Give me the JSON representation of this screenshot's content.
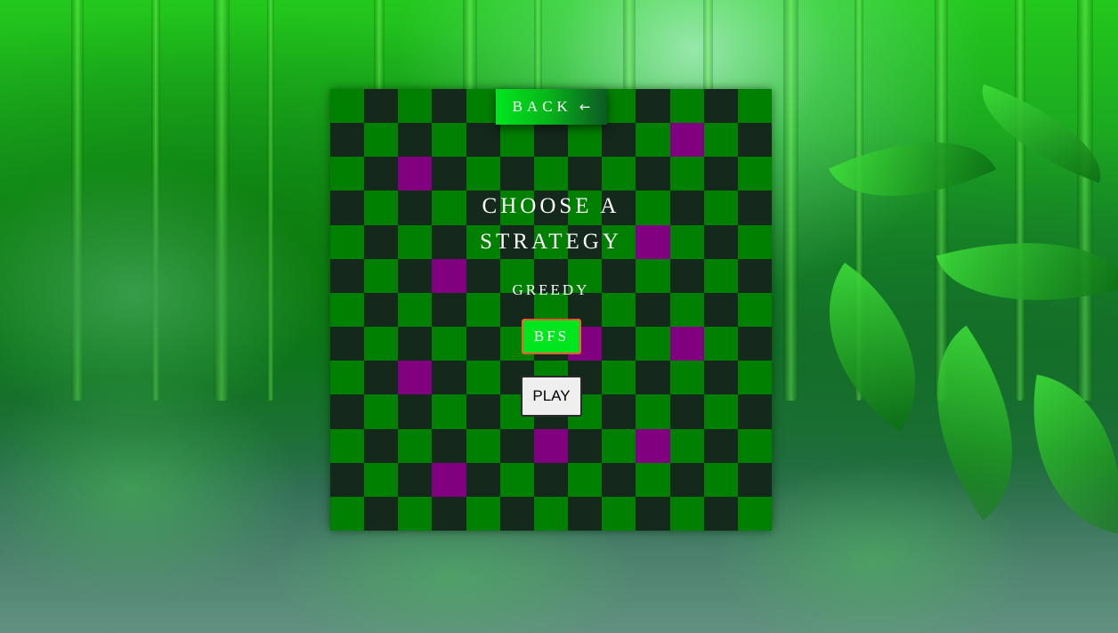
{
  "back_button": {
    "label": "BACK",
    "icon": "←"
  },
  "menu": {
    "title": "CHOOSE A STRATEGY",
    "strategies": [
      {
        "label": "GREEDY",
        "selected": false
      },
      {
        "label": "BFS",
        "selected": true
      }
    ],
    "play_label": "PLAY"
  },
  "board": {
    "size": 13,
    "obstacles": [
      [
        1,
        10
      ],
      [
        2,
        2
      ],
      [
        4,
        9
      ],
      [
        5,
        3
      ],
      [
        7,
        7
      ],
      [
        7,
        10
      ],
      [
        8,
        2
      ],
      [
        10,
        6
      ],
      [
        10,
        9
      ],
      [
        11,
        3
      ]
    ]
  },
  "colors": {
    "light_cell": "#008000",
    "dark_cell": "#15281c",
    "obstacle": "#800080",
    "accent_green": "#00e61e",
    "selected_border": "#ff5a36"
  }
}
